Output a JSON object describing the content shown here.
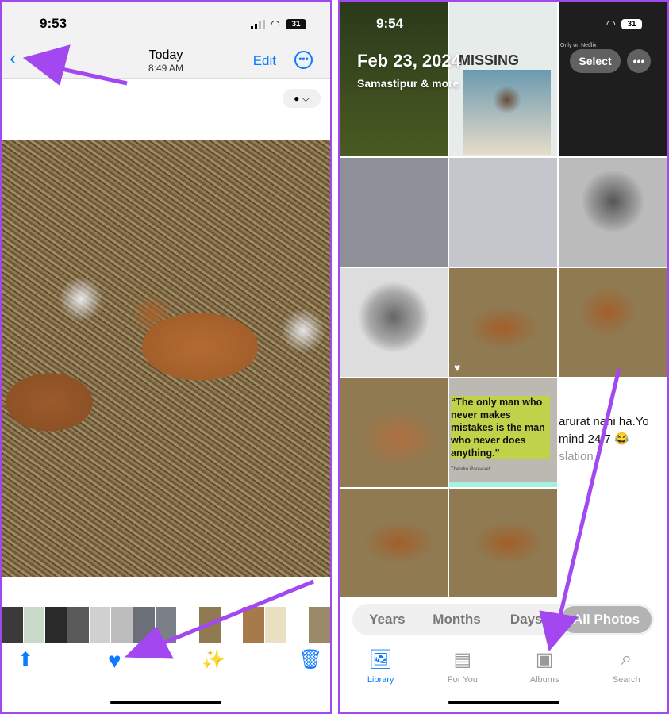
{
  "left": {
    "status": {
      "time": "9:53",
      "battery": "31"
    },
    "nav": {
      "title": "Today",
      "subtitle": "8:49 AM",
      "edit": "Edit",
      "back_icon": "chevron-left-icon",
      "more_icon": "ellipsis-circle-icon"
    },
    "filter_icon": "person-chevron-icon",
    "toolbar": {
      "share_icon": "share-icon",
      "favorite_icon": "heart-filled-icon",
      "edit_icon": "magic-paw-icon",
      "delete_icon": "trash-icon"
    },
    "thumb_colors": [
      "#3a3a3a",
      "#c9d9c9",
      "#2a2a2a",
      "#5a5a5a",
      "#d0d0d0",
      "#bdbdbd",
      "#6a6f78",
      "#7a7f88",
      "#fff",
      "#8f7a52",
      "#fff",
      "#a67a4a",
      "#e8e0c0",
      "#fff",
      "#9a8a6a"
    ]
  },
  "right": {
    "status": {
      "time": "9:54",
      "battery": "31"
    },
    "header": {
      "date": "Feb 23, 2024",
      "location": "Samastipur & more",
      "select": "Select"
    },
    "tile_texts": {
      "missing": "MISSING",
      "quote": "“The only man who never makes mistakes is the man who never does anything.”",
      "quote_author": "Theodre Roosevelt",
      "chat_line1": "arurat nahi ha.Yo",
      "chat_line2": "mind 24/7 😂",
      "chat_line3": "nslation",
      "netflix": "Only on Netflix"
    },
    "segments": [
      "Years",
      "Months",
      "Days",
      "All Photos"
    ],
    "selected_segment": "All Photos",
    "tabs": [
      {
        "label": "Library",
        "icon": "photo-library-icon",
        "active": true
      },
      {
        "label": "For You",
        "icon": "for-you-icon",
        "active": false
      },
      {
        "label": "Albums",
        "icon": "albums-stack-icon",
        "active": false
      },
      {
        "label": "Search",
        "icon": "search-icon",
        "active": false
      }
    ]
  },
  "colors": {
    "accent": "#0a7aff",
    "annotation": "#a347f0"
  }
}
